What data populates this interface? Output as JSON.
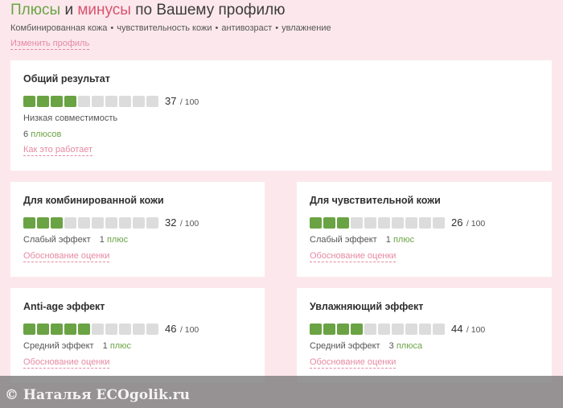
{
  "header": {
    "title_plus": "Плюсы",
    "title_and": "и",
    "title_minus": "минусы",
    "title_rest": "по Вашему профилю",
    "profile_tags": [
      "Комбинированная кожа",
      "чувствительность кожи",
      "антивозраст",
      "увлажнение"
    ],
    "tag_separator": "•",
    "change_profile_link": "Изменить профиль"
  },
  "overall": {
    "title": "Общий результат",
    "score": "37",
    "score_max": "/ 100",
    "filled_segments": 4,
    "total_segments": 10,
    "compatibility": "Низкая совместимость",
    "plus_count": "6",
    "plus_word": "плюсов",
    "how_link": "Как это работает"
  },
  "cards": [
    {
      "title": "Для комбинированной кожи",
      "score": "32",
      "score_max": "/ 100",
      "filled_segments": 3,
      "effect": "Слабый эффект",
      "plus_count": "1",
      "plus_word": "плюс",
      "reason_link": "Обоснование оценки"
    },
    {
      "title": "Для чувствительной кожи",
      "score": "26",
      "score_max": "/ 100",
      "filled_segments": 3,
      "effect": "Слабый эффект",
      "plus_count": "1",
      "plus_word": "плюс",
      "reason_link": "Обоснование оценки"
    },
    {
      "title": "Anti-age эффект",
      "score": "46",
      "score_max": "/ 100",
      "filled_segments": 5,
      "effect": "Средний эффект",
      "plus_count": "1",
      "plus_word": "плюс",
      "reason_link": "Обоснование оценки"
    },
    {
      "title": "Увлажняющий эффект",
      "score": "44",
      "score_max": "/ 100",
      "filled_segments": 4,
      "effect": "Средний эффект",
      "plus_count": "3",
      "plus_word": "плюса",
      "reason_link": "Обоснование оценки"
    }
  ],
  "colors": {
    "accent_green": "#6aa344",
    "accent_pink": "#e58aa3",
    "minus_red": "#d9536f",
    "segment_empty": "#dcdcdc",
    "page_background": "#fce8ec"
  },
  "watermark": "© Наталья ECOgolik.ru"
}
